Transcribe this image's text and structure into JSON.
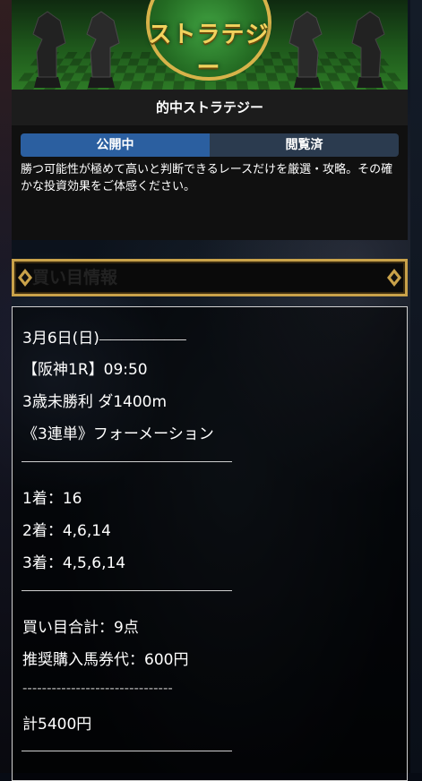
{
  "banner": {
    "title": "ストラテジー"
  },
  "strategy": {
    "title": "的中ストラテジー"
  },
  "tabs": [
    {
      "label": "公開中",
      "active": true
    },
    {
      "label": "閲覧済",
      "active": false
    }
  ],
  "description": "勝つ可能性が極めて高いと判断できるレースだけを厳選・攻略。その確かな投資効果をご体感ください。",
  "section": {
    "title": "買い目情報"
  },
  "info": {
    "date": "3月6日(日)",
    "date_rule": "――――――――",
    "race": "【阪神1R】09:50",
    "race_class": "3歳未勝利 ダ1400m",
    "bet_type": "《3連単》フォーメーション",
    "first": "1着：16",
    "second": "2着：4,6,14",
    "third": "3着：4,5,6,14",
    "total_points": "買い目合計：9点",
    "recommended": "推奨購入馬券代：600円",
    "dashes": "-------------------------------",
    "total_amount": "計5400円"
  },
  "colors": {
    "tab_active": "#2b5fa0",
    "tab_inactive": "#2b3b4f",
    "gold": "#c9a24a",
    "banner_green": "#2d7a26"
  }
}
